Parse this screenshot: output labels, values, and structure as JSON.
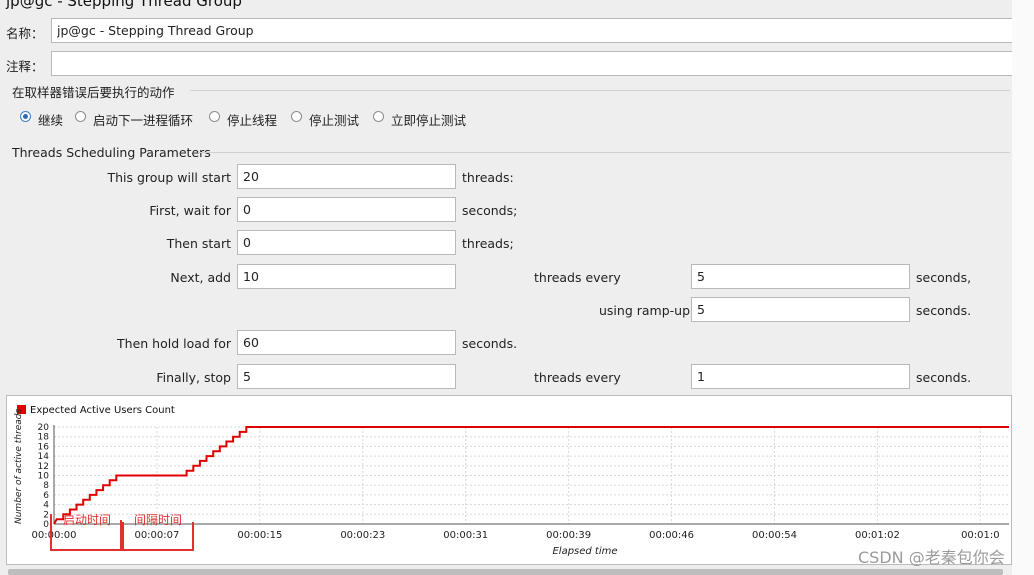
{
  "window_title": "jp@gc - Stepping Thread Group",
  "form": {
    "name_label": "名称：",
    "name_value": "jp@gc - Stepping Thread Group",
    "comment_label": "注释：",
    "comment_value": ""
  },
  "error_action": {
    "title": "在取样器错误后要执行的动作",
    "options": [
      "继续",
      "启动下一进程循环",
      "停止线程",
      "停止测试",
      "立即停止测试"
    ],
    "selected": "继续"
  },
  "scheduling": {
    "title": "Threads Scheduling Parameters",
    "start_threads": {
      "label": "This group will start",
      "value": "20",
      "unit": "threads:"
    },
    "first_wait": {
      "label": "First, wait for",
      "value": "0",
      "unit": "seconds;"
    },
    "then_start": {
      "label": "Then start",
      "value": "0",
      "unit": "threads;"
    },
    "next_add": {
      "label": "Next, add",
      "value": "10",
      "mid": "threads every",
      "value2": "5",
      "unit": "seconds,"
    },
    "ramp_up": {
      "label": "using ramp-up",
      "value": "5",
      "unit": "seconds."
    },
    "hold_load": {
      "label": "Then hold load for",
      "value": "60",
      "unit": "seconds."
    },
    "finally_stop": {
      "label": "Finally, stop",
      "value": "5",
      "mid": "threads every",
      "value2": "1",
      "unit": "seconds."
    }
  },
  "chart_data": {
    "type": "line",
    "legend": "Expected Active Users Count",
    "ylabel": "Number of active threads",
    "xlabel": "Elapsed time",
    "ylim": [
      0,
      20
    ],
    "yticks": [
      0,
      2,
      4,
      6,
      8,
      10,
      12,
      14,
      16,
      18,
      20
    ],
    "xticks": [
      "00:00:00",
      "00:00:07",
      "00:00:15",
      "00:00:23",
      "00:00:31",
      "00:00:39",
      "00:00:46",
      "00:00:54",
      "00:01:02",
      "00:01:0"
    ],
    "xlim_seconds": [
      0,
      72
    ],
    "series": [
      {
        "color": "#e00000",
        "points": [
          [
            0,
            0
          ],
          [
            0.2,
            1
          ],
          [
            0.7,
            1
          ],
          [
            0.7,
            2
          ],
          [
            1.2,
            2
          ],
          [
            1.2,
            3
          ],
          [
            1.7,
            3
          ],
          [
            1.7,
            4
          ],
          [
            2.2,
            4
          ],
          [
            2.2,
            5
          ],
          [
            2.7,
            5
          ],
          [
            2.7,
            6
          ],
          [
            3.2,
            6
          ],
          [
            3.2,
            7
          ],
          [
            3.7,
            7
          ],
          [
            3.7,
            8
          ],
          [
            4.2,
            8
          ],
          [
            4.2,
            9
          ],
          [
            4.7,
            9
          ],
          [
            4.7,
            10
          ],
          [
            10,
            10
          ],
          [
            10,
            11
          ],
          [
            10.5,
            11
          ],
          [
            10.5,
            12
          ],
          [
            11,
            12
          ],
          [
            11,
            13
          ],
          [
            11.5,
            13
          ],
          [
            11.5,
            14
          ],
          [
            12,
            14
          ],
          [
            12,
            15
          ],
          [
            12.5,
            15
          ],
          [
            12.5,
            16
          ],
          [
            13,
            16
          ],
          [
            13,
            17
          ],
          [
            13.5,
            17
          ],
          [
            13.5,
            18
          ],
          [
            14,
            18
          ],
          [
            14,
            19
          ],
          [
            14.5,
            19
          ],
          [
            14.5,
            20
          ],
          [
            72,
            20
          ]
        ]
      }
    ],
    "annotations": [
      "启动时间",
      "间隔时间"
    ],
    "annotation_color": "#e03030"
  },
  "watermark": "CSDN @老秦包你会"
}
